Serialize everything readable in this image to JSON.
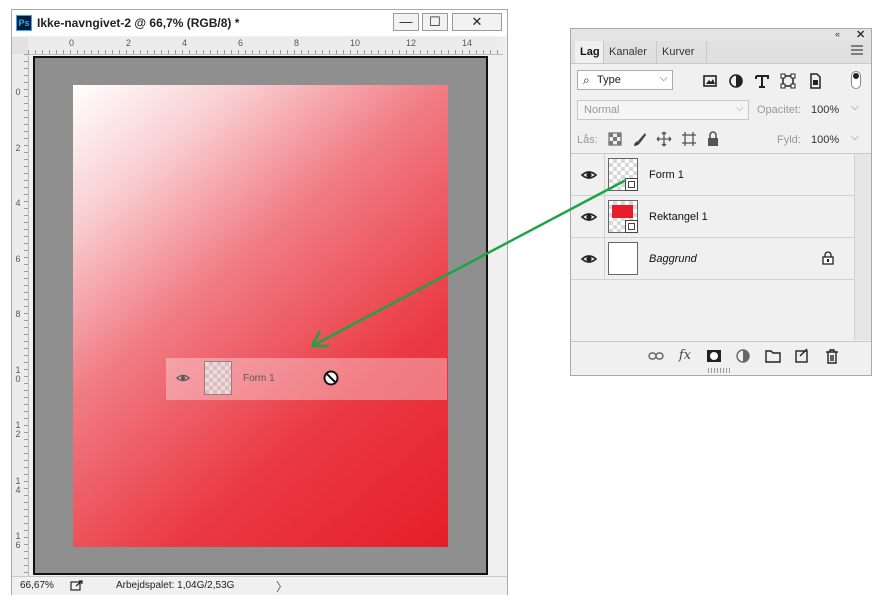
{
  "document": {
    "title": "Ikke-navngivet-2 @ 66,7% (RGB/8) *",
    "app_logo": "Ps",
    "window_buttons": {
      "minimize": "—",
      "maximize": "☐",
      "close": "✕"
    },
    "ruler_h_labels": [
      "0",
      "2",
      "4",
      "6",
      "8",
      "10",
      "12",
      "14"
    ],
    "ruler_v_labels": [
      "0",
      "2",
      "4",
      "6",
      "8",
      "10",
      "12",
      "14",
      "16"
    ],
    "drag_ghost": {
      "layer_name": "Form 1",
      "cursor": "not-allowed-icon"
    },
    "status": {
      "zoom": "66,67%",
      "memory": "Arbejdspalet: 1,04G/2,53G",
      "arrow": "〉"
    }
  },
  "layers_panel": {
    "collapse": "«",
    "close": "✕",
    "tabs": [
      "Lag",
      "Kanaler",
      "Kurver"
    ],
    "active_tab": "Lag",
    "filter": {
      "kind": "Type",
      "search_icon": "⌕",
      "caret": "⌵"
    },
    "filter_icons": [
      "image-filter-icon",
      "adjustment-filter-icon",
      "type-filter-icon",
      "shape-filter-icon",
      "smart-object-filter-icon"
    ],
    "blend_mode": "Normal",
    "opacity_label": "Opacitet:",
    "opacity_value": "100%",
    "lock_label": "Lås:",
    "fill_label": "Fyld:",
    "fill_value": "100%",
    "layers": [
      {
        "name": "Form 1",
        "visible": true,
        "thumbnail": "transparent-shape"
      },
      {
        "name": "Rektangel 1",
        "visible": true,
        "thumbnail": "red-shape",
        "color": "#e51e28"
      },
      {
        "name": "Baggrund",
        "visible": true,
        "thumbnail": "white",
        "locked": true
      }
    ],
    "bottom_icons": [
      "link-layers-icon",
      "fx-icon",
      "mask-icon",
      "adjustment-icon",
      "group-folder-icon",
      "new-layer-icon",
      "trash-icon"
    ],
    "bottom_glyphs": {
      "fx": "fx"
    }
  },
  "colors": {
    "arrow": "#1aa548",
    "canvas_red": "#e51e28",
    "pasteboard": "#8f8f8f"
  }
}
